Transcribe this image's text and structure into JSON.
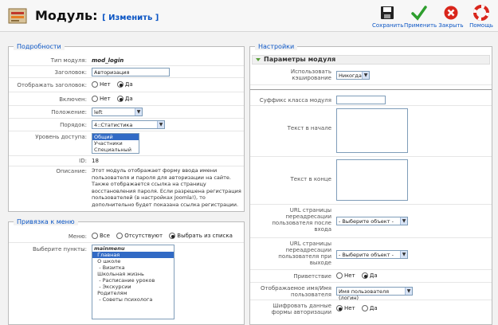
{
  "header": {
    "title": "Модуль:",
    "subtitle": "[ Изменить ]"
  },
  "toolbar": {
    "save": "Сохранить",
    "apply": "Применить",
    "close": "Закрыть",
    "help": "Помощь"
  },
  "details": {
    "legend": "Подробности",
    "module_type_label": "Тип модуля:",
    "module_type_value": "mod_login",
    "title_label": "Заголовок:",
    "title_value": "Авторизация",
    "show_title_label": "Отображать заголовок:",
    "enabled_label": "Включен:",
    "no": "Нет",
    "yes": "Да",
    "position_label": "Положение:",
    "position_value": "left",
    "order_label": "Порядок:",
    "order_value": "4::Статистика",
    "access_label": "Уровень доступа:",
    "access_options": [
      "Общий",
      "Участники",
      "Специальный"
    ],
    "id_label": "ID:",
    "id_value": "18",
    "description_label": "Описание:",
    "description_lines": [
      "Этот модуль отображает форму ввода имени",
      "пользователя и пароля для авторизации на сайте.",
      "Также отображается ссылка на страницу",
      "восстановления пароля. Если разрешена регистрация",
      "пользователей (в настройках Joomla!), то",
      "дополнительно будет показана ссылка регистрации."
    ]
  },
  "menu_binding": {
    "legend": "Привязка к меню",
    "menus_label": "Меню:",
    "opt_all": "Все",
    "opt_none": "Отсутствуют",
    "opt_select": "Выбрать из списка",
    "items_label": "Выберите пункты:",
    "items": [
      "mainmenu",
      "  Главная",
      "  О школе",
      "   - Визитка",
      "  Школьная жизнь",
      "   - Расписание уроков",
      "   - Экскурсии",
      "  Родителям",
      "   - Советы психолога"
    ]
  },
  "settings": {
    "legend": "Настройки",
    "params_title": "Параметры модуля",
    "cache_label_1": "Использовать",
    "cache_label_2": "кэширование",
    "cache_value": "Никогда",
    "suffix_label": "Суффикс класса модуля",
    "pretext_label": "Текст в начале",
    "posttext_label": "Текст в конце",
    "login_redirect_label": [
      "URL страницы",
      "переадресации",
      "пользователя после",
      "входа"
    ],
    "login_redirect_value": "- Выберите объект -",
    "logout_redirect_label": [
      "URL страницы",
      "переадресации",
      "пользователя при",
      "выходе"
    ],
    "logout_redirect_value": "- Выберите объект -",
    "greeting_label": "Приветствие",
    "name_label": [
      "Отображаемое имя/Имя",
      "пользователя"
    ],
    "name_value": "Имя пользователя (логин)",
    "encrypt_label": [
      "Шифровать данные",
      "формы авторизации"
    ],
    "no": "Нет",
    "yes": "Да"
  },
  "colors": {
    "link": "#0b55c4",
    "selected": "#316ac5",
    "accent_green": "#5a9e3b"
  }
}
